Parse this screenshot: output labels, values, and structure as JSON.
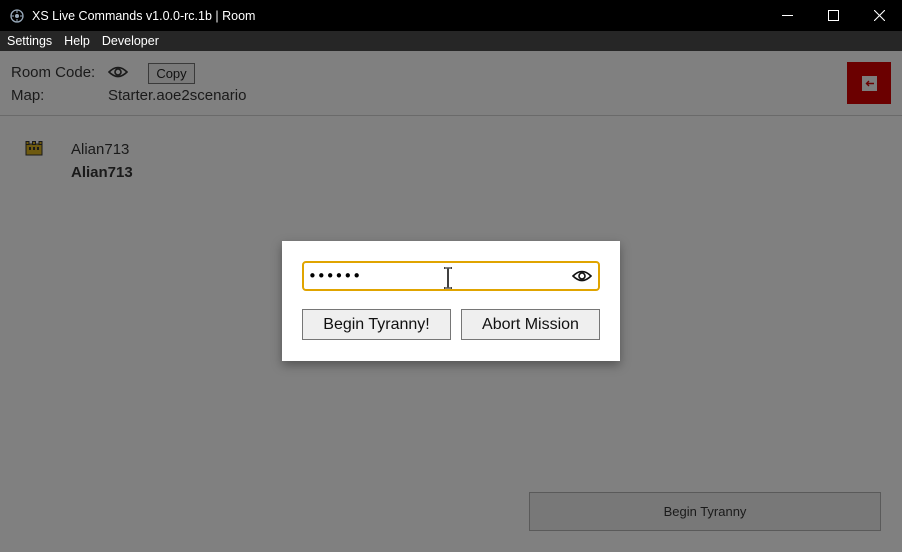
{
  "window": {
    "title": "XS Live Commands v1.0.0-rc.1b | Room",
    "minimize": "—",
    "maximize": "☐",
    "close": "✕"
  },
  "menu": [
    "Settings",
    "Help",
    "Developer"
  ],
  "room": {
    "code_label": "Room Code:",
    "copy_label": "Copy",
    "map_label": "Map:",
    "map_value": "Starter.aoe2scenario",
    "exit_icon": "exit-room-icon"
  },
  "player": {
    "name": "Alian713",
    "display_name": "Alian713",
    "icon": "castle-icon"
  },
  "footer": {
    "begin_label": "Begin Tyranny"
  },
  "modal": {
    "password_value": "••••••",
    "begin_label": "Begin Tyranny!",
    "abort_label": "Abort Mission",
    "accent": "#e0a400"
  }
}
